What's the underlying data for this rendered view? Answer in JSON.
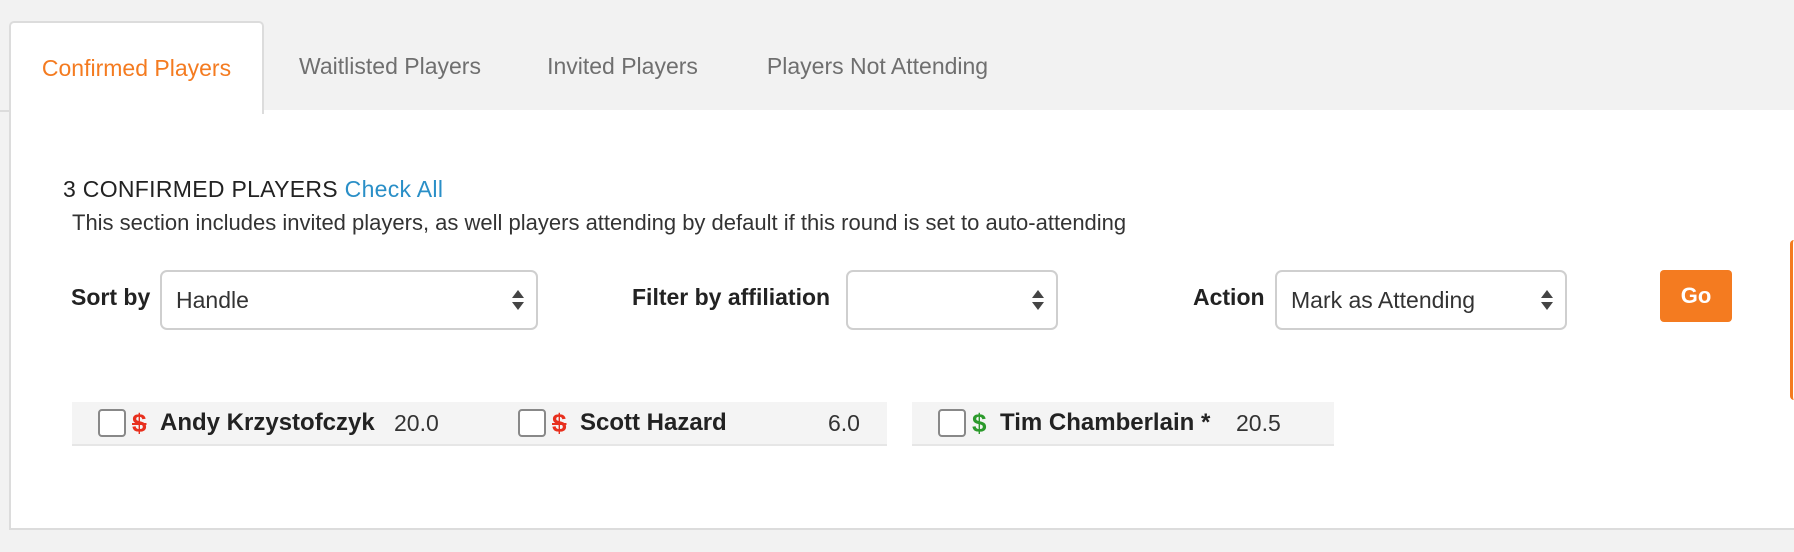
{
  "tabs": [
    {
      "label": "Confirmed Players",
      "active": true
    },
    {
      "label": "Waitlisted Players",
      "active": false
    },
    {
      "label": "Invited Players",
      "active": false
    },
    {
      "label": "Players Not Attending",
      "active": false
    }
  ],
  "summary": {
    "count_text": "3 CONFIRMED PLAYERS",
    "check_all": "Check All",
    "description": "This section includes invited players, as well players attending by default if this round is set to auto-attending"
  },
  "controls": {
    "sort_label": "Sort by",
    "sort_value": "Handle",
    "filter_label": "Filter by affiliation",
    "filter_value": "",
    "action_label": "Action",
    "action_value": "Mark as Attending",
    "go_label": "Go"
  },
  "players": [
    {
      "name": "Andy Krzystofczyk",
      "handicap": "20.0",
      "paid": false,
      "dollar": "$"
    },
    {
      "name": "Scott Hazard",
      "handicap": "6.0",
      "paid": false,
      "dollar": "$"
    },
    {
      "name": "Tim Chamberlain *",
      "handicap": "20.5",
      "paid": true,
      "dollar": "$"
    }
  ],
  "colors": {
    "accent": "#f47b20",
    "link": "#2a8fc7",
    "unpaid": "#e8301e",
    "paid": "#2c9a2c"
  }
}
